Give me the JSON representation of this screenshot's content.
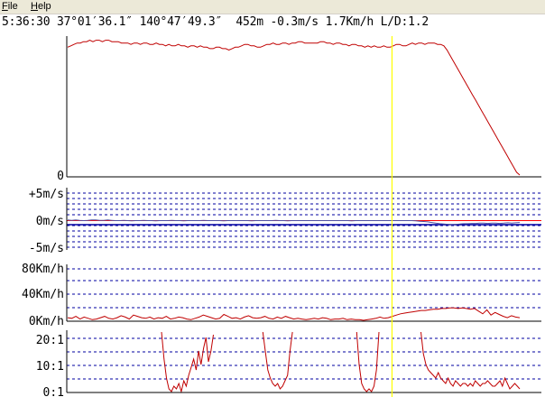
{
  "menu": {
    "file": {
      "accel": "F",
      "rest": "ile"
    },
    "help": {
      "accel": "H",
      "rest": "elp"
    }
  },
  "status": {
    "time": "5:36:30",
    "lat": "37°01′36.1″",
    "lon": "140°47′49.3″",
    "alt": "452m",
    "vario": "-0.3m/s",
    "speed": "1.7Km/h",
    "ld": "L/D:1.2"
  },
  "colors": {
    "trace": "#c00000",
    "grid": "#0000a0",
    "cursor": "#ffff00",
    "axis": "#000000",
    "zeroline": "#ff0000"
  },
  "cursor_fraction": 0.72,
  "charts": [
    {
      "name": "altitude",
      "type": "line",
      "tick_labels": [
        "0"
      ],
      "values": [
        92,
        93,
        94,
        95,
        95,
        96,
        96,
        97,
        96,
        97,
        97,
        96,
        97,
        97,
        96,
        96,
        96,
        95,
        95,
        95,
        94,
        95,
        95,
        94,
        95,
        95,
        94,
        94,
        95,
        94,
        94,
        93,
        94,
        93,
        93,
        94,
        93,
        93,
        92,
        93,
        93,
        92,
        93,
        92,
        92,
        91,
        91,
        92,
        92,
        91,
        91,
        90,
        91,
        92,
        92,
        93,
        94,
        94,
        93,
        93,
        92,
        92,
        93,
        94,
        94,
        95,
        94,
        94,
        95,
        95,
        94,
        95,
        95,
        96,
        96,
        95,
        95,
        95,
        95,
        95,
        96,
        96,
        95,
        95,
        94,
        95,
        95,
        94,
        94,
        93,
        94,
        94,
        93,
        93,
        92,
        93,
        92,
        93,
        92,
        92,
        93,
        92,
        92,
        93,
        94,
        94,
        93,
        93,
        94,
        95,
        94,
        95,
        95,
        94,
        95,
        95,
        95,
        94,
        94,
        93,
        90,
        86,
        82,
        78,
        74,
        70,
        66,
        62,
        58,
        54,
        50,
        46,
        42,
        38,
        34,
        30,
        26,
        22,
        18,
        14,
        10,
        6,
        2,
        0
      ]
    },
    {
      "name": "vario",
      "type": "line",
      "tick_labels": [
        "+5m/s",
        "0m/s",
        "-5m/s"
      ],
      "ylim": [
        -5,
        5
      ],
      "values": [
        0.2,
        0.1,
        0.2,
        0.1,
        0.0,
        0.1,
        0.2,
        0.2,
        0.1,
        0.1,
        0.2,
        0.1,
        0.0,
        0.0,
        0.1,
        0.0,
        -0.1,
        0.0,
        0.0,
        0.1,
        0.0,
        0.0,
        -0.1,
        0.0,
        0.0,
        0.0,
        0.1,
        0.0,
        0.0,
        -0.1,
        0.0,
        0.0,
        0.0,
        0.0,
        0.1,
        0.0,
        0.0,
        0.0,
        0.0,
        -0.1,
        0.0,
        0.0,
        0.0,
        0.0,
        0.0,
        0.0,
        -0.1,
        0.0,
        0.0,
        0.0,
        0.0,
        0.0,
        0.1,
        0.0,
        0.0,
        -0.1,
        0.0,
        0.0,
        0.0,
        0.0,
        0.0,
        0.0,
        0.0,
        0.0,
        0.0,
        0.0,
        0.0,
        0.0,
        0.0,
        0.0,
        0.0,
        -0.1,
        0.0,
        0.0,
        0.0,
        0.0,
        0.0,
        0.0,
        0.0,
        0.0,
        0.0,
        0.0,
        0.0,
        0.0,
        0.0,
        0.0,
        0.0,
        -0.1,
        -0.2,
        -0.3,
        -0.4,
        -0.6,
        -0.8,
        -1.0,
        -1.1,
        -1.2,
        -1.3,
        -1.2,
        -1.1,
        -1.0,
        -1.0,
        -0.9,
        -0.9,
        -0.8,
        -0.8,
        -0.9,
        -0.8,
        -0.8,
        -0.9,
        -0.8,
        -0.7,
        -0.8,
        -0.7,
        -0.6
      ]
    },
    {
      "name": "speed",
      "type": "line",
      "tick_labels": [
        "80Km/h",
        "40Km/h",
        "0Km/h"
      ],
      "ylim": [
        0,
        80
      ],
      "values": [
        4,
        3,
        6,
        2,
        5,
        3,
        1,
        2,
        4,
        6,
        3,
        2,
        4,
        7,
        5,
        2,
        8,
        6,
        4,
        3,
        5,
        2,
        4,
        3,
        6,
        2,
        3,
        5,
        4,
        2,
        1,
        3,
        5,
        8,
        6,
        4,
        2,
        3,
        9,
        6,
        3,
        4,
        2,
        5,
        7,
        4,
        3,
        4,
        6,
        3,
        2,
        5,
        3,
        6,
        4,
        2,
        3,
        2,
        1,
        2,
        3,
        2,
        4,
        3,
        1,
        2,
        2,
        3,
        1,
        2,
        1,
        1,
        0,
        1,
        2,
        3,
        5,
        3,
        4,
        6,
        8,
        10,
        11,
        12,
        13,
        14,
        15,
        15,
        16,
        17,
        17,
        18,
        18,
        19,
        19,
        18,
        19,
        18,
        17,
        18,
        14,
        10,
        16,
        8,
        12,
        9,
        6,
        4,
        7,
        5,
        4
      ]
    },
    {
      "name": "glide-ratio",
      "type": "line",
      "tick_labels": [
        "20:1",
        "10:1",
        "0:1"
      ],
      "ylim": [
        0,
        20
      ],
      "values": [
        null,
        null,
        null,
        null,
        null,
        null,
        null,
        null,
        null,
        null,
        null,
        null,
        null,
        null,
        null,
        null,
        null,
        null,
        null,
        null,
        null,
        null,
        null,
        null,
        null,
        null,
        null,
        null,
        null,
        null,
        null,
        null,
        null,
        null,
        null,
        null,
        null,
        null,
        22,
        12,
        5,
        1,
        0,
        2,
        1,
        3,
        0,
        4,
        2,
        6,
        9,
        12,
        8,
        15,
        10,
        16,
        20,
        11,
        15,
        21,
        null,
        null,
        null,
        null,
        null,
        null,
        null,
        null,
        null,
        null,
        null,
        null,
        null,
        null,
        null,
        null,
        null,
        null,
        null,
        22,
        15,
        8,
        5,
        3,
        2,
        3,
        1,
        2,
        4,
        6,
        15,
        22,
        null,
        null,
        null,
        null,
        null,
        null,
        null,
        null,
        null,
        null,
        null,
        null,
        null,
        null,
        null,
        null,
        null,
        null,
        null,
        null,
        null,
        null,
        null,
        null,
        null,
        22,
        10,
        3,
        1,
        0,
        1,
        0,
        2,
        8,
        22,
        null,
        null,
        null,
        null,
        null,
        null,
        null,
        null,
        null,
        null,
        null,
        null,
        null,
        null,
        null,
        null,
        22,
        14,
        10,
        8,
        7,
        6,
        5,
        7,
        5,
        4,
        3,
        5,
        3,
        2,
        4,
        3,
        2,
        3,
        3,
        2,
        3,
        2,
        4,
        3,
        2,
        3,
        3,
        4,
        3,
        2,
        2,
        3,
        4,
        2,
        5,
        3,
        1,
        2,
        3,
        2,
        1
      ]
    }
  ]
}
